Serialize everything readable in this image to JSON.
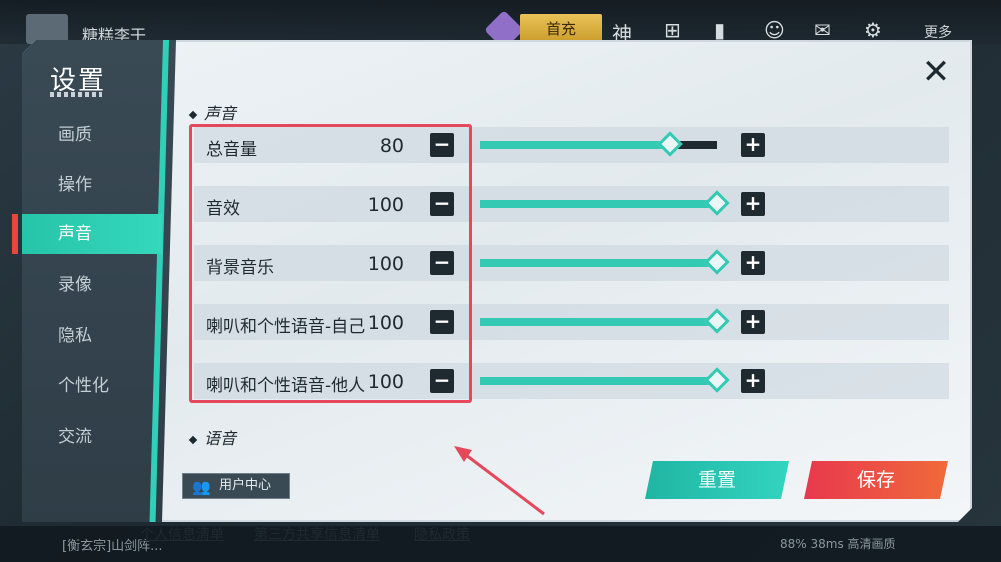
{
  "hud": {
    "player_name": "糖糕李干",
    "charge_label": "首充",
    "icons": [
      "shen-icon",
      "map-icon",
      "stats-icon",
      "friends-icon",
      "mail-icon",
      "gear-icon"
    ],
    "more_label": "更多",
    "chat_text": "[衡玄宗]山剑阵...",
    "status_text": "88%   38ms   高清画质"
  },
  "settings": {
    "title": "设置",
    "nav": [
      {
        "label": "画质"
      },
      {
        "label": "操作"
      },
      {
        "label": "声音"
      },
      {
        "label": "录像"
      },
      {
        "label": "隐私"
      },
      {
        "label": "个性化"
      },
      {
        "label": "交流"
      }
    ],
    "active_nav": "声音",
    "sections": {
      "sound_title": "声音",
      "voice_title": "语音"
    },
    "sliders": [
      {
        "label": "总音量",
        "value": "80",
        "fill_fraction": 0.8
      },
      {
        "label": "音效",
        "value": "100",
        "fill_fraction": 1.0
      },
      {
        "label": "背景音乐",
        "value": "100",
        "fill_fraction": 1.0
      },
      {
        "label": "喇叭和个性语音-自己",
        "value": "100",
        "fill_fraction": 1.0
      },
      {
        "label": "喇叭和个性语音-他人",
        "value": "100",
        "fill_fraction": 1.0
      }
    ],
    "minus_label": "−",
    "plus_label": "+",
    "close_label": "✕",
    "user_center_label": "用户中心",
    "reset_label": "重置",
    "save_label": "保存",
    "footer_links": [
      "个人信息清单",
      "第三方共享信息清单",
      "隐私政策"
    ]
  },
  "colors": {
    "accent": "#33c9b3",
    "save": "#e8384e",
    "highlight": "#e5475b",
    "dark": "#1f2a30"
  }
}
